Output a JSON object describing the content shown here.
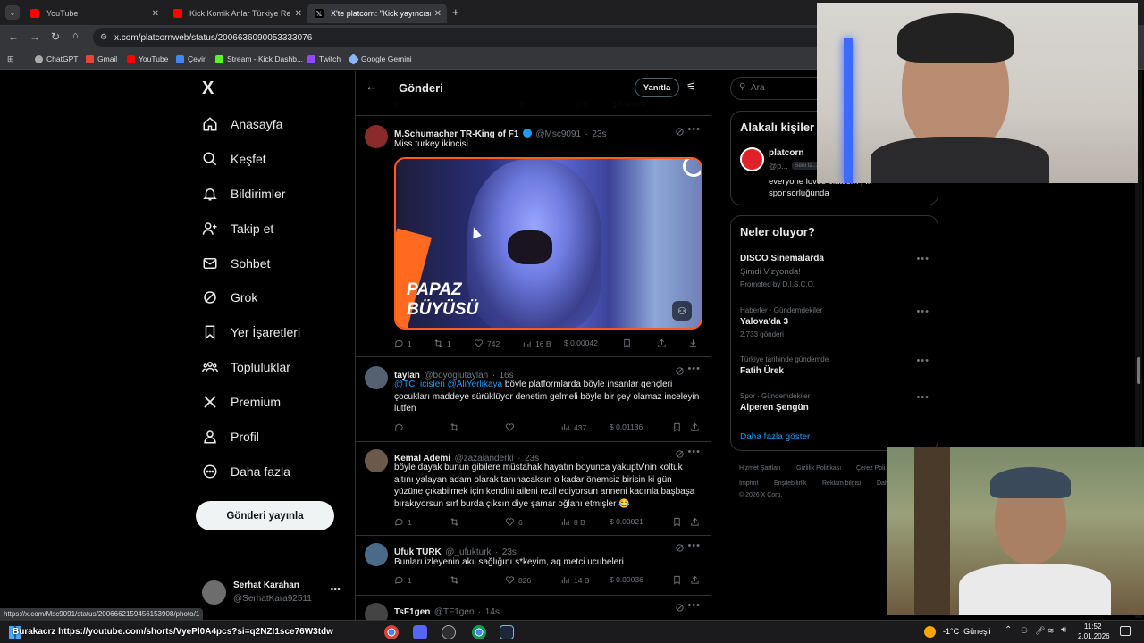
{
  "browser": {
    "tabs": [
      {
        "title": "YouTube",
        "color": "#ff0000"
      },
      {
        "title": "Kick Komik Anlar Türkiye Rewin",
        "color": "#ff0000"
      },
      {
        "title": "X'te platcorn: \"Kick yayıncısı Ca",
        "color": "#ffffff"
      }
    ],
    "new_tab": "+",
    "url": "x.com/platcornweb/status/2006636090053333076",
    "bookmarks": [
      {
        "label": "ChatGPT",
        "color": "#aaaaaa"
      },
      {
        "label": "Gmail",
        "color": "#ea4335"
      },
      {
        "label": "YouTube",
        "color": "#ff0000"
      },
      {
        "label": "Çevir",
        "color": "#4285f4"
      },
      {
        "label": "Stream - Kick Dashb...",
        "color": "#53fc18"
      },
      {
        "label": "Twitch",
        "color": "#9146ff"
      },
      {
        "label": "Google Gemini",
        "color": "#8ab4f8"
      }
    ],
    "status_url": "https://x.com/Msc9091/status/2006662159456153908/photo/1"
  },
  "nav": {
    "logo": "X",
    "items": [
      {
        "label": "Anasayfa",
        "icon": "home-icon"
      },
      {
        "label": "Keşfet",
        "icon": "search-icon"
      },
      {
        "label": "Bildirimler",
        "icon": "bell-icon"
      },
      {
        "label": "Takip et",
        "icon": "follow-icon"
      },
      {
        "label": "Sohbet",
        "icon": "mail-icon"
      },
      {
        "label": "Grok",
        "icon": "grok-icon"
      },
      {
        "label": "Yer İşaretleri",
        "icon": "bookmark-icon"
      },
      {
        "label": "Topluluklar",
        "icon": "communities-icon"
      },
      {
        "label": "Premium",
        "icon": "x-icon"
      },
      {
        "label": "Profil",
        "icon": "profile-icon"
      },
      {
        "label": "Daha fazla",
        "icon": "more-circle-icon"
      }
    ],
    "post_button": "Gönderi yayınla",
    "account": {
      "name": "Serhat Karahan",
      "handle": "@SerhatKara92511"
    }
  },
  "header": {
    "title": "Gönderi",
    "reply_button": "Yanıtla"
  },
  "prev_actions": {
    "replies": "1",
    "likes": "39",
    "views": "3 B",
    "tips": "$ 0.00008"
  },
  "tweets": [
    {
      "name": "M.Schumacher TR-King of F1",
      "handle": "@Msc9091",
      "time": "23s",
      "text": "Miss turkey ikincisi",
      "media_caption": "PAPAZ\nBÜYÜSÜ",
      "replies": "1",
      "reposts": "1",
      "likes": "742",
      "views": "16 B",
      "tips": "$ 0.00042",
      "avatar_color": "#8a2a2a"
    },
    {
      "name": "taylan",
      "handle": "@boyoglutaylan",
      "time": "16s",
      "mentions": "@TC_icisleri @AliYerlikaya",
      "text": " böyle platformlarda böyle insanlar gençleri çocukları maddeye sürüklüyor denetim gelmeli böyle bir şey olamaz inceleyin lütfen",
      "replies": "",
      "reposts": "",
      "likes": "",
      "views": "437",
      "tips": "$ 0.01136",
      "avatar_color": "#556070"
    },
    {
      "name": "Kemal Ademi",
      "handle": "@zazalanderki",
      "time": "23s",
      "text": "böyle dayak bunun gibilere müstahak hayatın boyunca yakuptv'nin koltuk altını yalayan adam olarak tanınacaksın o kadar önemsiz birisin ki gün yüzüne çıkabilmek için kendini aileni rezil ediyorsun anneni kadınla başbaşa bırakıyorsun sırf burda çıksın diye şamar oğlanı etmişler 😂",
      "replies": "1",
      "reposts": "",
      "likes": "6",
      "views": "8 B",
      "tips": "$ 0.00021",
      "avatar_color": "#6b5a4a"
    },
    {
      "name": "Ufuk TÜRK",
      "handle": "@_ufukturk",
      "time": "23s",
      "text": "Bunları izleyenin akıl sağlığını s*keyim, aq metci ucubeleri",
      "replies": "1",
      "reposts": "",
      "likes": "826",
      "views": "14 B",
      "tips": "$ 0.00036",
      "avatar_color": "#4a6a8a"
    },
    {
      "name": "TsF1gen",
      "handle": "@TF1gen",
      "time": "14s",
      "avatar_color": "#444"
    }
  ],
  "right": {
    "search_placeholder": "Ara",
    "related_title": "Alakalı kişiler",
    "related_person": {
      "name": "platcorn",
      "handle": "@p...",
      "badge": "Seni ta...",
      "bio": "everyone loves platcorn | ... sponsorluğunda"
    },
    "trends_title": "Neler oluyor?",
    "trends": [
      {
        "title": "DISCO Sinemalarda",
        "sub": "Şimdi Vizyonda!",
        "meta": "Promoted by D.I.S.C.O."
      },
      {
        "meta": "Haberler · Gündemdekiler",
        "title": "Yalova'da 3",
        "sub": "2.733 gönderi"
      },
      {
        "meta": "Türkiye tarihinde gündemde",
        "title": "Fatih Ürek",
        "sub": ""
      },
      {
        "meta": "Spor · Gündemdekiler",
        "title": "Alperen Şengün",
        "sub": ""
      }
    ],
    "show_more": "Daha fazla göster",
    "footer": [
      "Hizmet Şartları",
      "Gizlilik Politikası",
      "Çerez Poli...",
      "Imprint",
      "Erişilebilirlik",
      "Reklam bilgisi",
      "Dah...",
      "© 2026 X Corp."
    ]
  },
  "taskbar": {
    "ticker": "Burakacrz  https://youtube.com/shorts/VyePl0A4pcs?si=q2NZI1sce76W3tdw",
    "weather": "-1°C  Güneşli",
    "time": "11:52",
    "date": "2.01.2026"
  }
}
